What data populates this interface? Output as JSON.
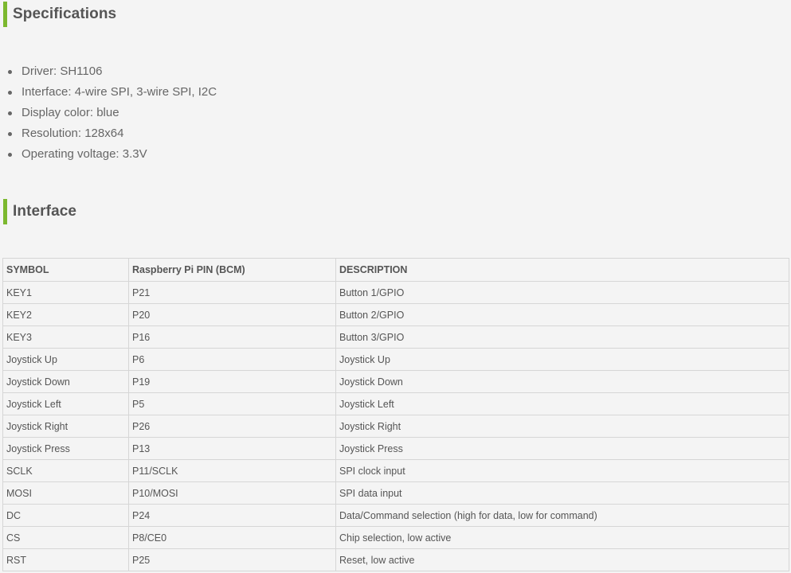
{
  "specifications": {
    "title": "Specifications",
    "items": [
      "Driver: SH1106",
      "Interface: 4-wire SPI, 3-wire SPI, I2C",
      "Display color: blue",
      "Resolution: 128x64",
      "Operating voltage: 3.3V"
    ]
  },
  "interface": {
    "title": "Interface",
    "table": {
      "headers": [
        "SYMBOL",
        "Raspberry Pi PIN (BCM)",
        "DESCRIPTION"
      ],
      "rows": [
        [
          "KEY1",
          "P21",
          "Button 1/GPIO"
        ],
        [
          "KEY2",
          "P20",
          "Button 2/GPIO"
        ],
        [
          "KEY3",
          "P16",
          "Button 3/GPIO"
        ],
        [
          "Joystick Up",
          "P6",
          "Joystick Up"
        ],
        [
          "Joystick Down",
          "P19",
          "Joystick Down"
        ],
        [
          "Joystick Left",
          "P5",
          "Joystick Left"
        ],
        [
          "Joystick Right",
          "P26",
          "Joystick Right"
        ],
        [
          "Joystick Press",
          "P13",
          "Joystick Press"
        ],
        [
          "SCLK",
          "P11/SCLK",
          "SPI clock input"
        ],
        [
          "MOSI",
          "P10/MOSI",
          "SPI data input"
        ],
        [
          "DC",
          "P24",
          "Data/Command selection (high for data, low for command)"
        ],
        [
          "CS",
          "P8/CE0",
          "Chip selection, low active"
        ],
        [
          "RST",
          "P25",
          "Reset, low active"
        ]
      ]
    }
  },
  "colors": {
    "accent": "#7cb82f",
    "text": "#555555",
    "background": "#f4f4f4",
    "border": "#d6d6d6"
  }
}
